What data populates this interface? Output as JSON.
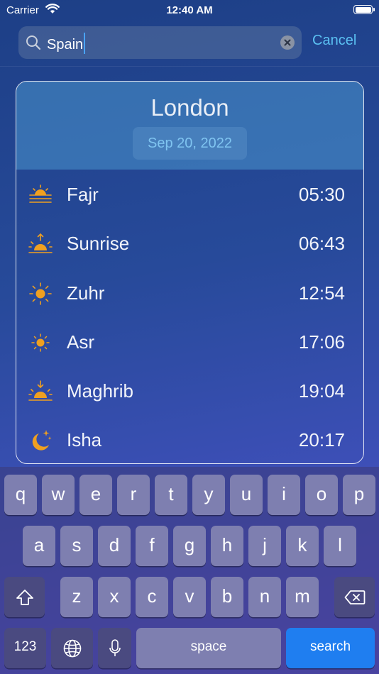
{
  "status_bar": {
    "carrier": "Carrier",
    "time": "12:40 AM"
  },
  "search": {
    "value": "Spain",
    "cancel_label": "Cancel"
  },
  "card": {
    "city": "London",
    "date": "Sep 20, 2022",
    "prayers": [
      {
        "name": "Fajr",
        "time": "05:30",
        "icon": "sunrise-lines-icon"
      },
      {
        "name": "Sunrise",
        "time": "06:43",
        "icon": "sunrise-up-icon"
      },
      {
        "name": "Zuhr",
        "time": "12:54",
        "icon": "sun-icon"
      },
      {
        "name": "Asr",
        "time": "17:06",
        "icon": "sun-small-icon"
      },
      {
        "name": "Maghrib",
        "time": "19:04",
        "icon": "sunset-down-icon"
      },
      {
        "name": "Isha",
        "time": "20:17",
        "icon": "moon-stars-icon"
      }
    ]
  },
  "keyboard": {
    "row1": [
      "q",
      "w",
      "e",
      "r",
      "t",
      "y",
      "u",
      "i",
      "o",
      "p"
    ],
    "row2": [
      "a",
      "s",
      "d",
      "f",
      "g",
      "h",
      "j",
      "k",
      "l"
    ],
    "row3": [
      "z",
      "x",
      "c",
      "v",
      "b",
      "n",
      "m"
    ],
    "numbers_label": "123",
    "space_label": "space",
    "search_label": "search"
  },
  "colors": {
    "accent": "#5bc1f2",
    "icon": "#f0a020",
    "search_key": "#1f7ef0"
  }
}
